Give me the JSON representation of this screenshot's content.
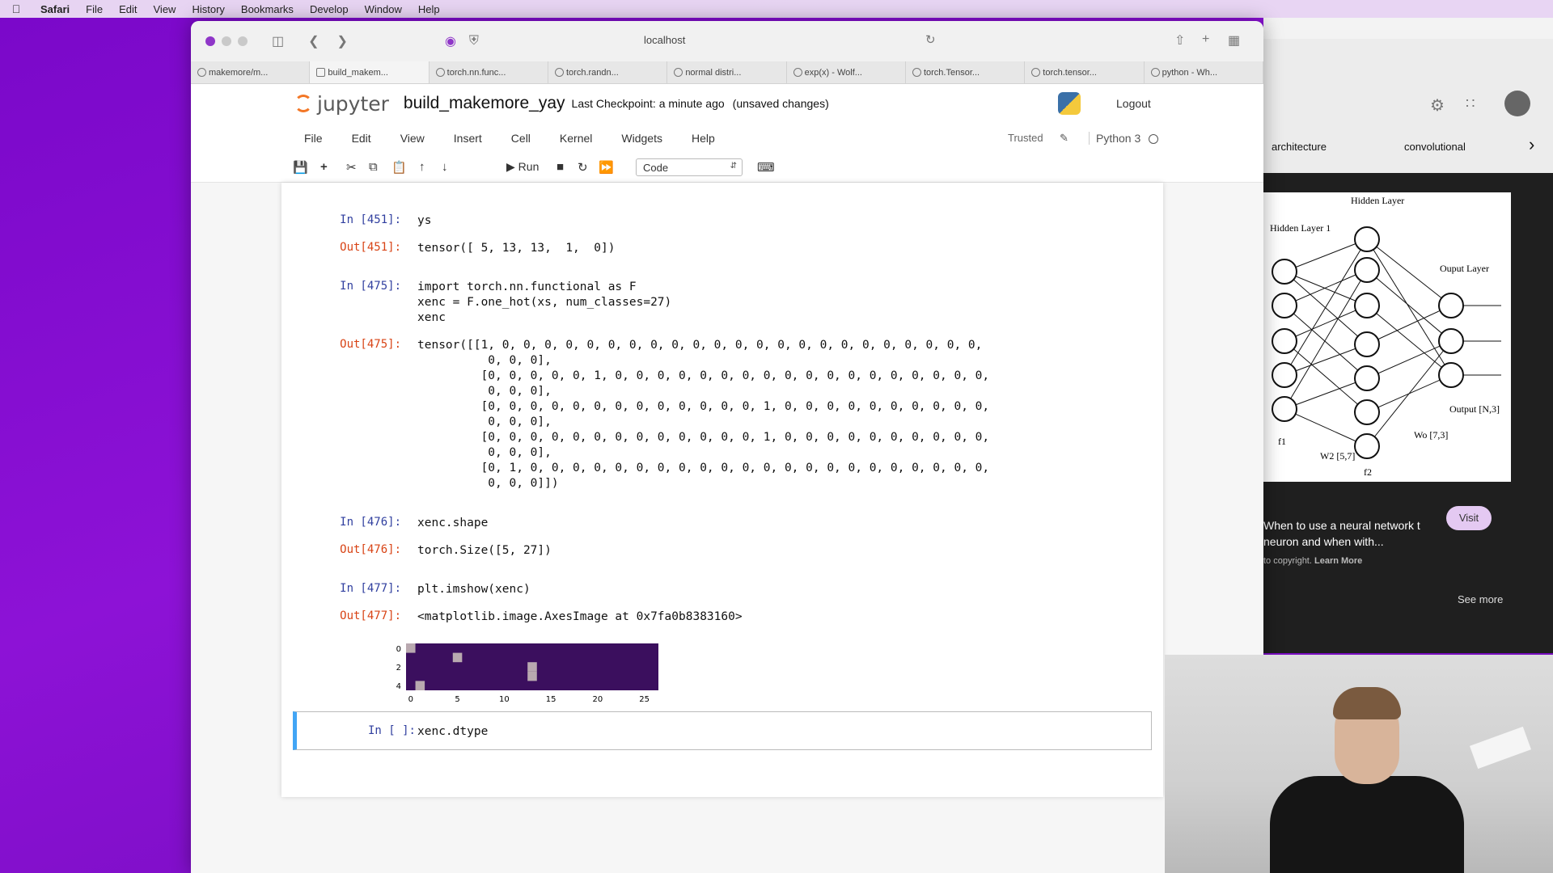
{
  "menubar": {
    "app": "Safari",
    "items": [
      "File",
      "Edit",
      "View",
      "History",
      "Bookmarks",
      "Develop",
      "Window",
      "Help"
    ]
  },
  "browser": {
    "address": "localhost",
    "tabs": [
      "makemore/m...",
      "build_makem...",
      "torch.nn.func...",
      "torch.randn...",
      "normal distri...",
      "exp(x) - Wolf...",
      "torch.Tensor...",
      "torch.tensor...",
      "python - Wh..."
    ]
  },
  "jupyter": {
    "logo_text": "jupyter",
    "notebook_name": "build_makemore_yay",
    "checkpoint": "Last Checkpoint: a minute ago",
    "unsaved": "(unsaved changes)",
    "logout": "Logout",
    "menu": [
      "File",
      "Edit",
      "View",
      "Insert",
      "Cell",
      "Kernel",
      "Widgets",
      "Help"
    ],
    "trusted": "Trusted",
    "kernel": "Python 3",
    "run_label": "Run",
    "cell_type": "Code"
  },
  "cells": [
    {
      "in_prompt": "In [451]:",
      "code": "ys",
      "out_prompt": "Out[451]:",
      "output": "tensor([ 5, 13, 13,  1,  0])"
    },
    {
      "in_prompt": "In [475]:",
      "code_lines": [
        "import torch.nn.functional as F",
        "xenc = F.one_hot(xs, num_classes=27)",
        "xenc"
      ],
      "out_prompt": "Out[475]:",
      "output": "tensor([[1, 0, 0, 0, 0, 0, 0, 0, 0, 0, 0, 0, 0, 0, 0, 0, 0, 0, 0, 0, 0, 0, 0, 0,\n          0, 0, 0],\n         [0, 0, 0, 0, 0, 1, 0, 0, 0, 0, 0, 0, 0, 0, 0, 0, 0, 0, 0, 0, 0, 0, 0, 0,\n          0, 0, 0],\n         [0, 0, 0, 0, 0, 0, 0, 0, 0, 0, 0, 0, 0, 1, 0, 0, 0, 0, 0, 0, 0, 0, 0, 0,\n          0, 0, 0],\n         [0, 0, 0, 0, 0, 0, 0, 0, 0, 0, 0, 0, 0, 1, 0, 0, 0, 0, 0, 0, 0, 0, 0, 0,\n          0, 0, 0],\n         [0, 1, 0, 0, 0, 0, 0, 0, 0, 0, 0, 0, 0, 0, 0, 0, 0, 0, 0, 0, 0, 0, 0, 0,\n          0, 0, 0]])"
    },
    {
      "in_prompt": "In [476]:",
      "code": "xenc.shape",
      "out_prompt": "Out[476]:",
      "output": "torch.Size([5, 27])"
    },
    {
      "in_prompt": "In [477]:",
      "code": "plt.imshow(xenc)",
      "out_prompt": "Out[477]:",
      "output": "<matplotlib.image.AxesImage at 0x7fa0b8383160>"
    },
    {
      "in_prompt": "In [ ]:",
      "code": "xenc.dtype"
    }
  ],
  "imshow": {
    "rows": 5,
    "cols": 27,
    "hot": [
      [
        0,
        0
      ],
      [
        1,
        5
      ],
      [
        2,
        13
      ],
      [
        3,
        13
      ],
      [
        4,
        1
      ]
    ],
    "x_ticks": [
      "0",
      "5",
      "10",
      "15",
      "20",
      "25"
    ],
    "y_ticks": [
      "0",
      "2",
      "4"
    ],
    "bg_color": "#3b0f5e",
    "hot_color": "#b9a9b0"
  },
  "right_panel": {
    "chips": [
      "architecture",
      "convolutional"
    ],
    "image_labels": {
      "hidden1": "Hidden Layer 1",
      "hidden2": "Hidden Layer",
      "output_layer": "Ouput Layer",
      "output": "Output [N,3]",
      "w2": "W2 [5,7]",
      "wo": "Wo [7,3]",
      "f1": "f1",
      "f2": "f2"
    },
    "result_title": "When to use a neural network t neuron and when with...",
    "copyright": "to copyright.",
    "learn_more": "Learn More",
    "visit": "Visit",
    "see_more": "See more"
  }
}
